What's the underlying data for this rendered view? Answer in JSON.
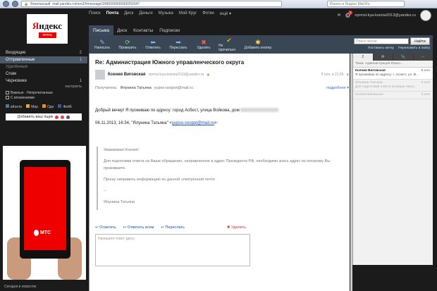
{
  "browser": {
    "security_label": "Безопасный",
    "url": "mail.yandex.ru/neo2/#message/2490000000006250347",
    "search_placeholder": "Искать в Яндекс.Mail.Ru"
  },
  "services": [
    "Поиск",
    "Почта",
    "Диск",
    "Деньги",
    "Музыка",
    "Мой Круг",
    "Фотки",
    "ещё ▾"
  ],
  "services_active_index": 1,
  "user": {
    "email": "nprmsl-kya-ksenia2013@yandex.ru"
  },
  "logo": {
    "word_red": "Я",
    "word": "ндекс",
    "sub": "почта"
  },
  "tabs": [
    "Письма",
    "Диск",
    "Контакты",
    "Подписки"
  ],
  "toolbar": {
    "items": [
      {
        "label": "Написать",
        "icon": "pencil-icon",
        "glyph": "✎",
        "color": "blue"
      },
      {
        "label": "Проверить",
        "icon": "refresh-icon",
        "glyph": "⟳",
        "color": "green"
      },
      {
        "label": "Ответить",
        "icon": "reply-icon",
        "glyph": "⬅",
        "color": "blue"
      },
      {
        "label": "Переслать",
        "icon": "forward-icon",
        "glyph": "➡",
        "color": "blue"
      },
      {
        "label": "Удалить",
        "icon": "delete-icon",
        "glyph": "✖",
        "color": "red"
      },
      {
        "label": "Не прочитано",
        "icon": "check-icon",
        "glyph": "✔",
        "color": "orange"
      },
      {
        "label": "Добавить кнопку",
        "icon": "star-icon",
        "glyph": "✱",
        "color": "yellow"
      }
    ],
    "search_placeholder": "Поиск писем",
    "find_label": "Найти",
    "link_label": "Поставить метку",
    "link_move": "Переложить в папку"
  },
  "folders": [
    {
      "label": "Входящие",
      "count": "2"
    },
    {
      "label": "Отправленные",
      "count": "1"
    },
    {
      "label": "Удалённые",
      "count": ""
    },
    {
      "label": "Спам",
      "count": ""
    },
    {
      "label": "Черновики",
      "count": "1"
    }
  ],
  "folders_setup": "настроить",
  "flags": [
    "Важные · Непрочитанные",
    "С вложениями"
  ],
  "socials": [
    "вКонте",
    "Мир",
    "Одн",
    "Фейб"
  ],
  "add_mailbox": "Добавить ваш ящик",
  "ad": {
    "brand": "МТС"
  },
  "footnews": "Сегодня в новостях",
  "mail": {
    "subject": "Re: Администрация Южного управленческого округа",
    "sender_name": "Ксения Виговская",
    "sender_email": "nprmsl-kya-ksenia2013@yandex.ru",
    "date": "8 ноя. в 21:56",
    "to_label": "Получатель:",
    "to_name": "Ялунина Татьяна",
    "to_email": "yupso-soopot@mail.ru",
    "more": "подробнее",
    "greeting": "Добрый вечер! Я проживаю по адресу: город Асбест, улица Войкова, дом",
    "quote_header": "06.11.2013, 16:34, \"Ялунина Татьяна\" <",
    "quote_email": "yupso-soopot@mail.ru",
    "quote_header_end": ">:",
    "quote": [
      "Уважаемая Ксения!",
      "Для подготовки ответа на Ваше обращение, направленное в адрес Президента РФ, необходимо знать адрес по которому Вы проживаете.",
      "Прошу направить информацию по данной электронной почте",
      "--",
      "Ялунина Татьяна"
    ],
    "actions": [
      "Ответить",
      "Ответить всем",
      "Переслать"
    ],
    "delete": "Удалить",
    "reply_placeholder": "Напишите ответ здесь"
  },
  "rpanel": {
    "tabs": [
      "2",
      "✉",
      "📎",
      "⋯"
    ],
    "thread_title": "Тема: Администрация Южно...",
    "items": [
      {
        "from": "Ксения Виговская",
        "date": "9 ноя.",
        "snip": "Я проживаю по адресу: г. Асбест, ул. В...",
        "sel": true,
        "dim": false
      },
      {
        "from": "Ялунина Татьяна",
        "date": "6 ноя.",
        "snip": "Для подготовки ответа на Ваше обра...",
        "sel": false,
        "dim": true
      },
      {
        "from": "Ксения Виговская",
        "date": "5 ноя.",
        "snip": "",
        "sel": false,
        "dim": true
      }
    ]
  }
}
